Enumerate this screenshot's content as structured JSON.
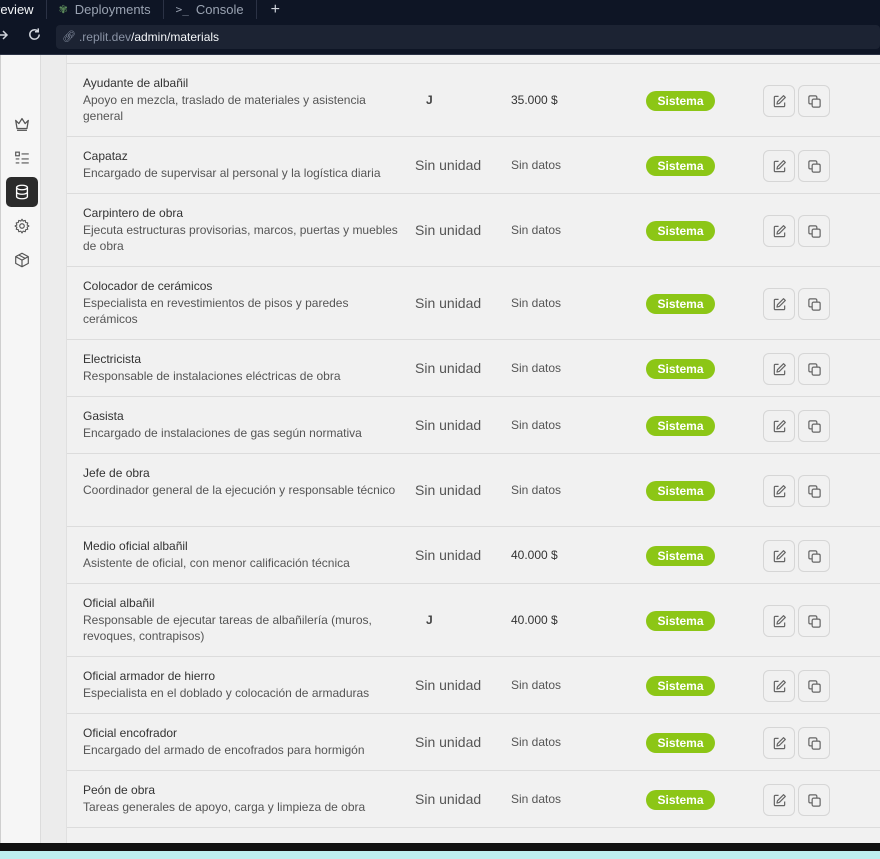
{
  "tabs": [
    {
      "label": "review",
      "icon": "",
      "active": true
    },
    {
      "label": "Deployments",
      "icon": "deployments-icon",
      "active": false
    },
    {
      "label": "Console",
      "icon": "console-icon",
      "active": false
    }
  ],
  "tab_add": "+",
  "url": {
    "host": ".replit.dev",
    "path": "/admin/materials"
  },
  "sidebar_icons": [
    "crown-icon",
    "list-icon",
    "database-icon",
    "gear-icon",
    "box-icon"
  ],
  "badge_color": "#8cc616",
  "rows": [
    {
      "name": "Ayudante de albañil",
      "desc": "Apoyo en mezcla, traslado de materiales y asistencia general",
      "unit": "J",
      "price": "35.000 $",
      "badge": "Sistema"
    },
    {
      "name": "Capataz",
      "desc": "Encargado de supervisar al personal y la logística diaria",
      "unit": "Sin unidad",
      "price": "Sin datos",
      "badge": "Sistema"
    },
    {
      "name": "Carpintero de obra",
      "desc": "Ejecuta estructuras provisorias, marcos, puertas y muebles de obra",
      "unit": "Sin unidad",
      "price": "Sin datos",
      "badge": "Sistema"
    },
    {
      "name": "Colocador de cerámicos",
      "desc": "Especialista en revestimientos de pisos y paredes cerámicos",
      "unit": "Sin unidad",
      "price": "Sin datos",
      "badge": "Sistema"
    },
    {
      "name": "Electricista",
      "desc": "Responsable de instalaciones eléctricas de obra",
      "unit": "Sin unidad",
      "price": "Sin datos",
      "badge": "Sistema"
    },
    {
      "name": "Gasista",
      "desc": "Encargado de instalaciones de gas según normativa",
      "unit": "Sin unidad",
      "price": "Sin datos",
      "badge": "Sistema"
    },
    {
      "name": "Jefe de obra",
      "desc": "Coordinador general de la ejecución y responsable técnico",
      "unit": "Sin unidad",
      "price": "Sin datos",
      "badge": "Sistema"
    },
    {
      "name": "Medio oficial albañil",
      "desc": "Asistente de oficial, con menor calificación técnica",
      "unit": "Sin unidad",
      "price": "40.000 $",
      "badge": "Sistema"
    },
    {
      "name": "Oficial albañil",
      "desc": "Responsable de ejecutar tareas de albañilería (muros, revoques, contrapisos)",
      "unit": "J",
      "price": "40.000 $",
      "badge": "Sistema"
    },
    {
      "name": "Oficial armador de hierro",
      "desc": "Especialista en el doblado y colocación de armaduras",
      "unit": "Sin unidad",
      "price": "Sin datos",
      "badge": "Sistema"
    },
    {
      "name": "Oficial encofrador",
      "desc": "Encargado del armado de encofrados para hormigón",
      "unit": "Sin unidad",
      "price": "Sin datos",
      "badge": "Sistema"
    },
    {
      "name": "Peón de obra",
      "desc": "Tareas generales de apoyo, carga y limpieza de obra",
      "unit": "Sin unidad",
      "price": "Sin datos",
      "badge": "Sistema"
    }
  ]
}
